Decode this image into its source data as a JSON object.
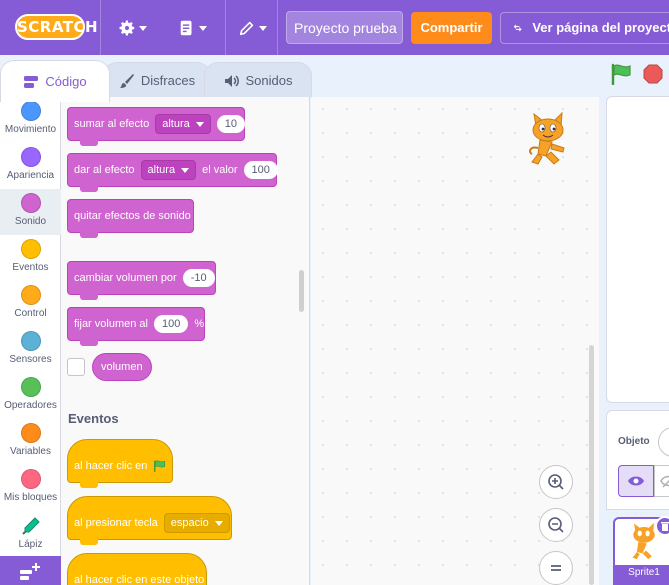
{
  "menubar": {
    "logo": "SCRATCH",
    "project_title": "Proyecto prueba",
    "share_label": "Compartir",
    "project_page_label": "Ver página del proyecto",
    "icons": [
      "gear-icon",
      "file-icon",
      "pencil-icon"
    ]
  },
  "tabs": [
    {
      "label": "Código",
      "icon": "code-icon",
      "active": true
    },
    {
      "label": "Disfraces",
      "icon": "brush-icon",
      "active": false
    },
    {
      "label": "Sonidos",
      "icon": "speaker-icon",
      "active": false
    }
  ],
  "categories": [
    {
      "label": "Movimiento",
      "color": "#4c97ff"
    },
    {
      "label": "Apariencia",
      "color": "#9966ff"
    },
    {
      "label": "Sonido",
      "color": "#cf63cf",
      "active": true
    },
    {
      "label": "Eventos",
      "color": "#ffbf00"
    },
    {
      "label": "Control",
      "color": "#ffab19"
    },
    {
      "label": "Sensores",
      "color": "#5cb1d6"
    },
    {
      "label": "Operadores",
      "color": "#59c059"
    },
    {
      "label": "Variables",
      "color": "#ff8c1a"
    },
    {
      "label": "Mis bloques",
      "color": "#ff6680"
    },
    {
      "label": "Lápiz",
      "icon": "pen-icon"
    }
  ],
  "palette": {
    "sound_blocks": {
      "change_effect": {
        "text": "sumar al efecto",
        "effect": "altura",
        "value": "10"
      },
      "set_effect": {
        "text": "dar al efecto",
        "effect": "altura",
        "text2": "el valor",
        "value": "100"
      },
      "clear_effects": {
        "text": "quitar efectos de sonido"
      },
      "change_volume": {
        "text": "cambiar volumen por",
        "value": "-10"
      },
      "set_volume": {
        "text": "fijar volumen al",
        "value": "100",
        "unit": "%"
      },
      "volume_reporter": {
        "text": "volumen"
      }
    },
    "events_title": "Eventos",
    "event_blocks": {
      "flag_clicked": {
        "text": "al hacer clic en"
      },
      "key_pressed": {
        "text": "al presionar tecla",
        "key": "espacio"
      },
      "sprite_clicked": {
        "text": "al hacer clic en este objeto"
      }
    }
  },
  "sprite_info": {
    "label": "Objeto"
  },
  "sprites": [
    {
      "name": "Sprite1",
      "selected": true
    }
  ]
}
